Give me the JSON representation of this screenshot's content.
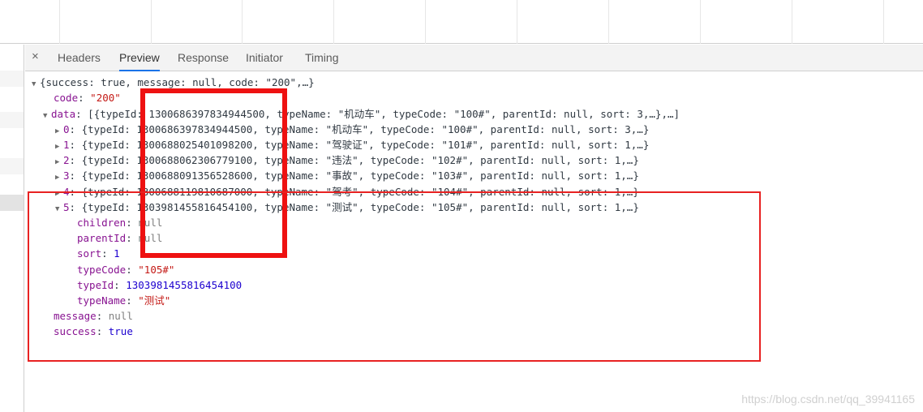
{
  "tabs": {
    "close_icon": "×",
    "items": [
      "Headers",
      "Preview",
      "Response",
      "Initiator",
      "Timing"
    ],
    "active": "Preview"
  },
  "preview": {
    "root_summary": "{success: true, message: null, code: \"200\",…}",
    "code_key": "code",
    "code_value": "\"200\"",
    "data_key": "data",
    "data_summary": "[{typeId: 1300686397834944500, typeName: \"机动车\", typeCode: \"100#\", parentId: null, sort: 3,…},…]",
    "items": [
      {
        "index": "0",
        "summary": "{typeId: 1300686397834944500, typeName: \"机动车\", typeCode: \"100#\", parentId: null, sort: 3,…}"
      },
      {
        "index": "1",
        "summary": "{typeId: 1300688025401098200, typeName: \"驾驶证\", typeCode: \"101#\", parentId: null, sort: 1,…}"
      },
      {
        "index": "2",
        "summary": "{typeId: 1300688062306779100, typeName: \"违法\", typeCode: \"102#\", parentId: null, sort: 1,…}"
      },
      {
        "index": "3",
        "summary": "{typeId: 1300688091356528600, typeName: \"事故\", typeCode: \"103#\", parentId: null, sort: 1,…}"
      },
      {
        "index": "4",
        "summary": "{typeId: 1300688119810687000, typeName: \"驾考\", typeCode: \"104#\", parentId: null, sort: 1,…}"
      },
      {
        "index": "5",
        "summary": "{typeId: 1303981455816454100, typeName: \"测试\", typeCode: \"105#\", parentId: null, sort: 1,…}"
      }
    ],
    "expanded": {
      "children_key": "children",
      "children_value": "null",
      "parentId_key": "parentId",
      "parentId_value": "null",
      "sort_key": "sort",
      "sort_value": "1",
      "typeCode_key": "typeCode",
      "typeCode_value": "\"105#\"",
      "typeId_key": "typeId",
      "typeId_value": "1303981455816454100",
      "typeName_key": "typeName",
      "typeName_value": "\"测试\""
    },
    "message_key": "message",
    "message_value": "null",
    "success_key": "success",
    "success_value": "true"
  },
  "watermark": "https://blog.csdn.net/qq_39941165",
  "colors": {
    "annotation_red": "#ee1111",
    "key": "#881391",
    "string": "#c41a16",
    "number": "#1c00cf",
    "active_tab_underline": "#1a73e8"
  }
}
